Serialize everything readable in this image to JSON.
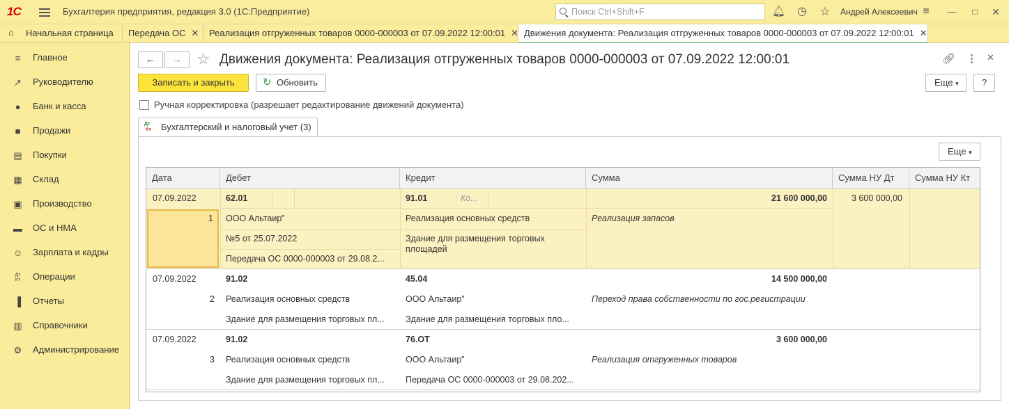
{
  "app": {
    "logo": "1С",
    "title": "Бухгалтерия предприятия, редакция 3.0  (1С:Предприятие)",
    "search_placeholder": "Поиск Ctrl+Shift+F",
    "user": "Андрей Алексеевич"
  },
  "tabs": [
    "Начальная страница",
    "Передача ОС",
    "Реализация отгруженных товаров 0000-000003 от 07.09.2022 12:00:01",
    "Движения документа: Реализация отгруженных товаров 0000-000003 от 07.09.2022 12:00:01"
  ],
  "sidebar": [
    "Главное",
    "Руководителю",
    "Банк и касса",
    "Продажи",
    "Покупки",
    "Склад",
    "Производство",
    "ОС и НМА",
    "Зарплата и кадры",
    "Операции",
    "Отчеты",
    "Справочники",
    "Администрирование"
  ],
  "doc": {
    "title": "Движения документа: Реализация отгруженных товаров 0000-000003 от 07.09.2022 12:00:01",
    "save_close": "Записать и закрыть",
    "refresh": "Обновить",
    "more": "Еще",
    "help": "?",
    "manual_label": "Ручная корректировка (разрешает редактирование движений документа)",
    "register_tab": "Бухгалтерский и налоговый учет (3)",
    "dtkt_top": "Дт",
    "dtkt_bottom": "Кт"
  },
  "grid": {
    "headers": [
      "Дата",
      "Дебет",
      "Кредит",
      "Сумма",
      "Сумма НУ Дт",
      "Сумма НУ Кт"
    ],
    "rows": [
      {
        "date": "07.09.2022",
        "num": "1",
        "debit": "62.01",
        "debit_sub": [
          "ООО Альтаир\"",
          "№5 от 25.07.2022",
          "Передача ОС 0000-000003 от 29.08.2..."
        ],
        "credit": "91.01",
        "credit_extra": "Ко...",
        "credit_sub": [
          "Реализация основных средств",
          "Здание для размещения торговых",
          "площадей"
        ],
        "sum": "21 600 000,00",
        "content": "Реализация запасов",
        "nu_dt": "3 600 000,00"
      },
      {
        "date": "07.09.2022",
        "num": "2",
        "debit": "91.02",
        "debit_sub": [
          "Реализация основных средств",
          "Здание для размещения торговых пл..."
        ],
        "credit": "45.04",
        "credit_sub": [
          "ООО Альтаир\"",
          "Здание для размещения торговых пло..."
        ],
        "sum": "14 500 000,00",
        "content": "Переход права собственности по гос.регистрации"
      },
      {
        "date": "07.09.2022",
        "num": "3",
        "debit": "91.02",
        "debit_sub": [
          "Реализация основных средств",
          "Здание для размещения торговых пл..."
        ],
        "credit": "76.ОТ",
        "credit_sub": [
          "ООО Альтаир\"",
          "Передача ОС 0000-000003 от 29.08.202..."
        ],
        "sum": "3 600 000,00",
        "content": "Реализация отгруженных товаров"
      }
    ]
  },
  "colors": {
    "yellow_bg": "#fbec9b",
    "selected_row": "#fcf1c0",
    "save_button": "#fce43c",
    "active_tab_underline": "#43a34b"
  }
}
